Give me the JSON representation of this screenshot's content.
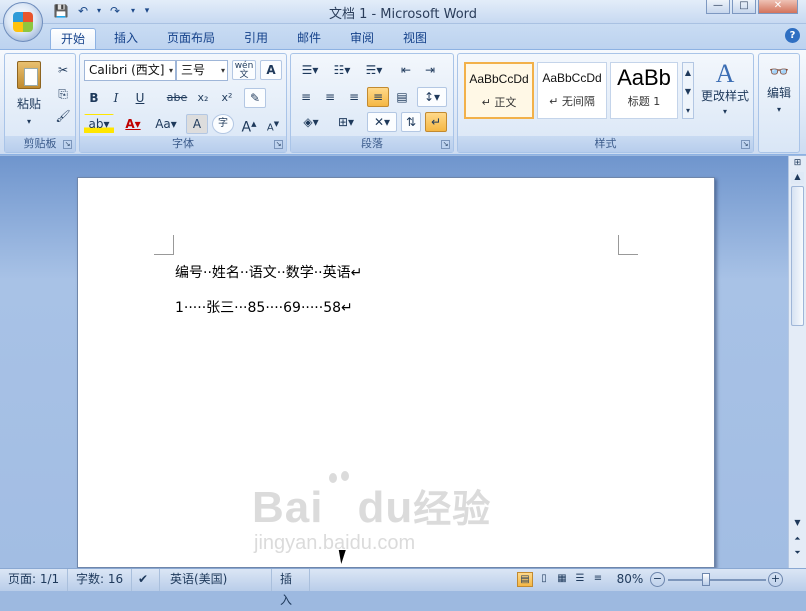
{
  "window": {
    "title": "文档 1 - Microsoft Word"
  },
  "qat": {
    "save_icon": "save-icon",
    "undo_icon": "undo-icon",
    "redo_icon": "redo-icon",
    "customize_icon": "chevron-down-icon"
  },
  "tabs": [
    {
      "label": "开始",
      "active": true
    },
    {
      "label": "插入"
    },
    {
      "label": "页面布局"
    },
    {
      "label": "引用"
    },
    {
      "label": "邮件"
    },
    {
      "label": "审阅"
    },
    {
      "label": "视图"
    }
  ],
  "ribbon": {
    "clipboard": {
      "group_label": "剪贴板",
      "paste_label": "粘贴"
    },
    "font": {
      "group_label": "字体",
      "font_name": "Calibri (西文]",
      "font_size": "三号",
      "bold": "B",
      "italic": "I",
      "underline": "U",
      "strike": "abe",
      "subscript": "x₂",
      "superscript": "x²",
      "grow": "A",
      "shrink": "A",
      "change_case": "Aa",
      "char_shade": "A",
      "enclose": "字",
      "phonetic": "wén 文",
      "border_char": "A"
    },
    "paragraph": {
      "group_label": "段落"
    },
    "styles": {
      "group_label": "样式",
      "items": [
        {
          "sample": "AaBbCcDd",
          "name": "↵ 正文",
          "selected": true
        },
        {
          "sample": "AaBbCcDd",
          "name": "↵ 无间隔"
        },
        {
          "sample": "AaBb",
          "name": "标题 1"
        }
      ],
      "change_styles": "更改样式"
    },
    "editing": {
      "label": "编辑"
    }
  },
  "document": {
    "lines": [
      "编号··姓名··语文··数学··英语↵",
      "1·····张三···85····69·····58↵"
    ]
  },
  "statusbar": {
    "page": "页面: 1/1",
    "words": "字数: 16",
    "language": "英语(美国)",
    "mode": "插入",
    "zoom": "80%"
  },
  "watermark": {
    "brand": "Bai",
    "brand2": "du",
    "cn": "经验",
    "url": "jingyan.baidu.com"
  }
}
